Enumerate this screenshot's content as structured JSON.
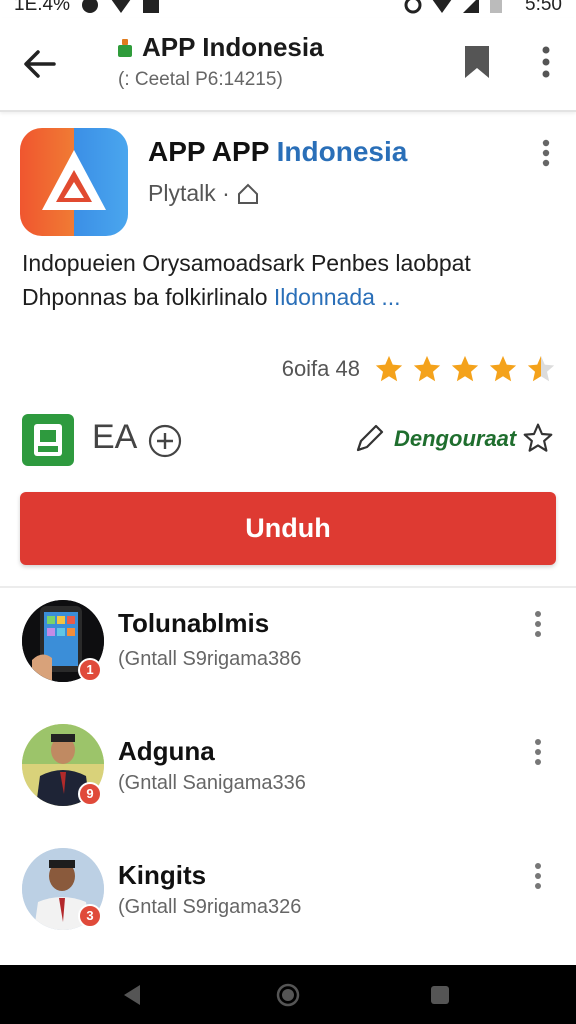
{
  "status_bar": {
    "left_text": "1E.4%",
    "time": "5:50"
  },
  "app_bar": {
    "title": "APP Indonesia",
    "subtitle": "(: Ceetal P6:14215)"
  },
  "app": {
    "name_part1": "APP APP",
    "name_part2": "Indonesia",
    "developer": "Plytalk ·",
    "description": "Indopueien Orysamoadsark Penbes laobpat Dhponnas ba folkirlinalo",
    "description_link": "Ildonnada ...",
    "rating_label": "6oifa 48",
    "stars": 4.5,
    "badge_label": "EA",
    "developer_link": "Dengouraat",
    "install_label": "Unduh"
  },
  "list": [
    {
      "title": "Tolunablmis",
      "subtitle": "(Gntall S9rigama386",
      "badge": "1"
    },
    {
      "title": "Adguna",
      "subtitle": "(Gntall Sanigama336",
      "badge": "9"
    },
    {
      "title": "Kingits",
      "subtitle": "(Gntall S9rigama326",
      "badge": "3"
    }
  ],
  "colors": {
    "install": "#de3a32",
    "link": "#2a6fb8",
    "star": "#f4a21b",
    "dev_green": "#1f6e2e"
  },
  "icons": [
    "back-arrow-icon",
    "bookmark-icon",
    "more-vert-icon",
    "star-icon",
    "plus-circle-icon",
    "pencil-icon",
    "star-outline-icon"
  ]
}
